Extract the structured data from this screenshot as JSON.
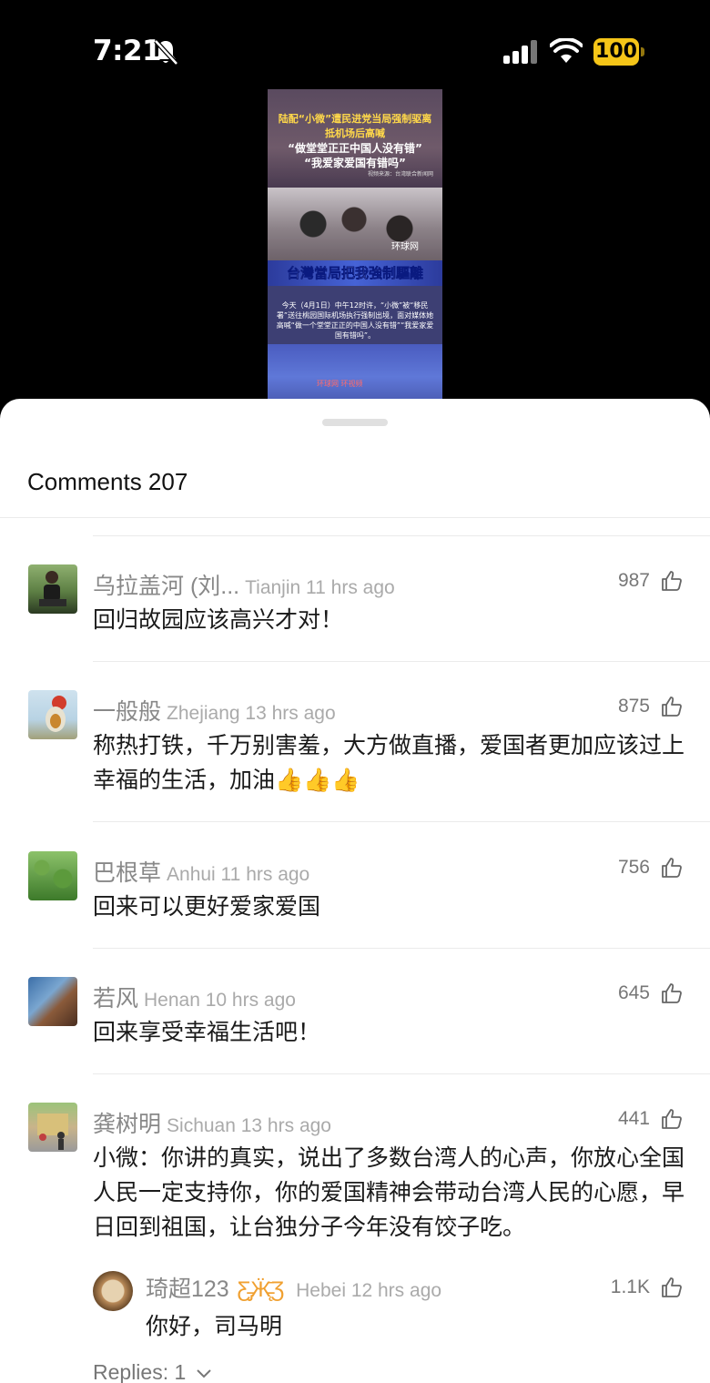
{
  "status_bar": {
    "time": "7:21",
    "battery": "100"
  },
  "video": {
    "headline_1": "陆配“小微”遭民进党当局强制驱离",
    "headline_2": "抵机场后高喊",
    "headline_3": "“做堂堂正正中国人没有错”",
    "headline_4": "“我爱家爱国有错吗”",
    "source": "视频来源：台湾联合新闻网",
    "brand": "环球网",
    "banner": "台灣當局把我強制驅離",
    "body": "今天（4月1日）中午12时许，“小微”被“移民署”送往桃园国际机场执行强制出境，面对媒体她高喊“做一个堂堂正正的中国人没有错”“我爱家爱国有错吗”。",
    "footer_logo": "环球网  环视频"
  },
  "comments_header": {
    "title": "Comments 207"
  },
  "comments": [
    {
      "name": "乌拉盖河 (刘...",
      "meta": "Tianjin 11 hrs ago",
      "likes": "987",
      "text": "回归故园应该高兴才对！"
    },
    {
      "name": "一般般",
      "meta": "Zhejiang 13 hrs ago",
      "likes": "875",
      "text": "称热打铁，千万别害羞，大方做直播，爱国者更加应该过上幸福的生活，加油👍👍👍"
    },
    {
      "name": "巴根草",
      "meta": "Anhui 11 hrs ago",
      "likes": "756",
      "text": "回来可以更好爱家爱国"
    },
    {
      "name": "若风",
      "meta": "Henan 10 hrs ago",
      "likes": "645",
      "text": "回来享受幸福生活吧！"
    },
    {
      "name": "龚树明",
      "meta": "Sichuan 13 hrs ago",
      "likes": "441",
      "text": "小微：你讲的真实，说出了多数台湾人的心声，你放心全国人民一定支持你，你的爱国精神会带动台湾人民的心愿，早日回到祖国，让台独分子今年没有饺子吃。"
    }
  ],
  "reply": {
    "name": "琦超123",
    "badge": "ʍ",
    "meta": "Hebei 12 hrs ago",
    "likes": "1.1K",
    "text": "你好，司马明"
  },
  "replies_link": "Replies: 1",
  "colors": {
    "battery": "#f5c518",
    "sheet": "#ffffff",
    "meta": "#aaaaaa"
  },
  "icons": [
    "bell-off-icon",
    "signal-icon",
    "wifi-icon",
    "battery-icon",
    "thumbs-up-icon",
    "chevron-down-icon",
    "butterfly-badge-icon"
  ]
}
